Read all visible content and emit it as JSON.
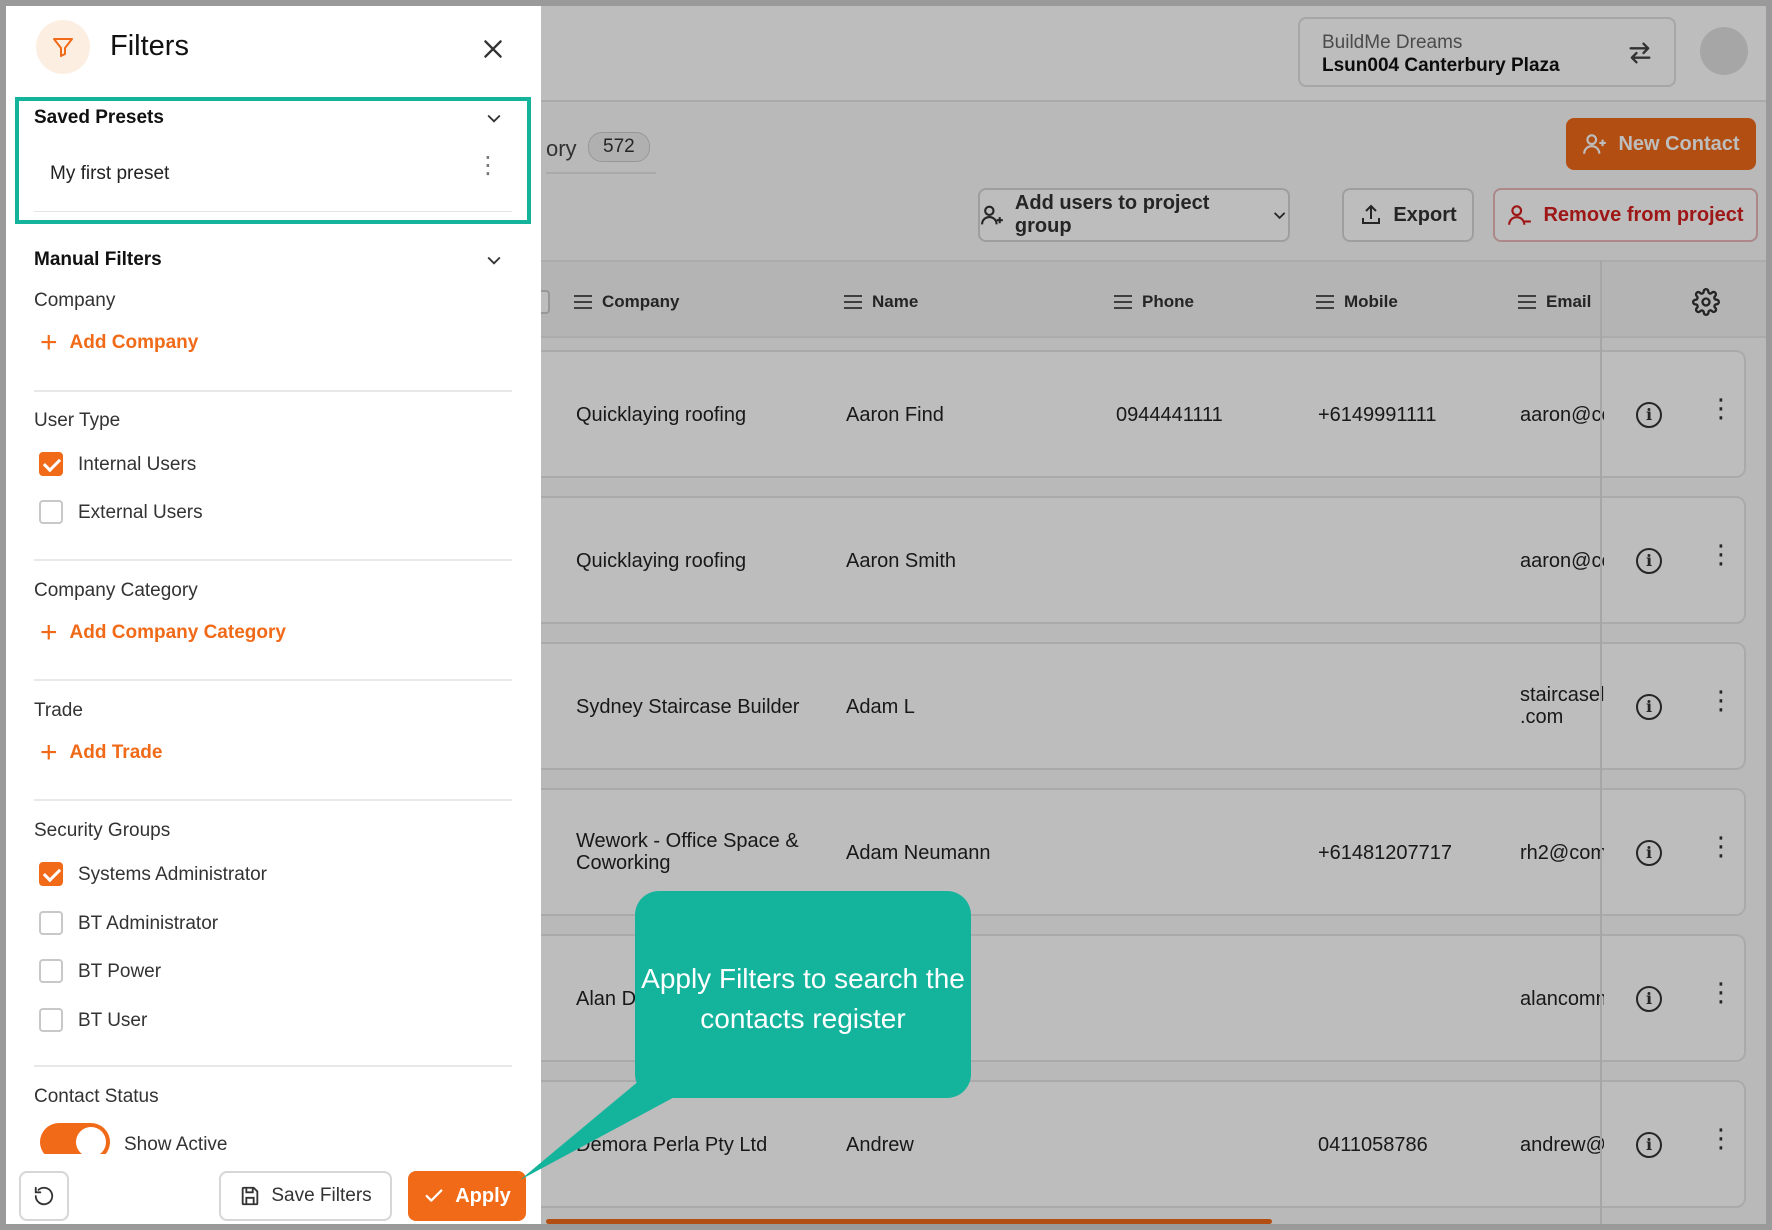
{
  "header": {
    "org_name": "BuildMe Dreams",
    "project_name": "Lsun004 Canterbury Plaza"
  },
  "tab": {
    "label_fragment": "ory",
    "count": "572"
  },
  "actions": {
    "new_contact": "New Contact",
    "add_to_group": "Add users to project group",
    "export": "Export",
    "remove_from_project": "Remove from project"
  },
  "table": {
    "columns": [
      "Company",
      "Name",
      "Phone",
      "Mobile",
      "Email"
    ],
    "rows": [
      {
        "company": "Quicklaying roofing",
        "name": "Aaron Find",
        "phone": "0944441111",
        "mobile": "+6149991111",
        "email": "aaron@cc"
      },
      {
        "company": "Quicklaying roofing",
        "name": "Aaron Smith",
        "phone": "",
        "mobile": "",
        "email": "aaron@cc"
      },
      {
        "company": "Sydney Staircase Builder",
        "name": "Adam L",
        "phone": "",
        "mobile": "",
        "email": "staircasel .com"
      },
      {
        "company": "Wework - Office Space & Coworking",
        "name": "Adam Neumann",
        "phone": "",
        "mobile": "+61481207717",
        "email": "rh2@com"
      },
      {
        "company": "Alan De",
        "name": "",
        "phone": "",
        "mobile": "",
        "email": "alancomn"
      },
      {
        "company": "Demora Perla Pty Ltd",
        "name": "Andrew",
        "phone": "",
        "mobile": "0411058786",
        "email": "andrew@"
      }
    ]
  },
  "filters": {
    "title": "Filters",
    "saved_presets": {
      "title": "Saved Presets",
      "items": [
        "My first preset"
      ]
    },
    "manual_filters": {
      "title": "Manual Filters"
    },
    "company": {
      "label": "Company",
      "add": "Add Company"
    },
    "user_type": {
      "label": "User Type",
      "options": [
        {
          "label": "Internal Users",
          "checked": true
        },
        {
          "label": "External Users",
          "checked": false
        }
      ]
    },
    "company_category": {
      "label": "Company Category",
      "add": "Add Company Category"
    },
    "trade": {
      "label": "Trade",
      "add": "Add Trade"
    },
    "security_groups": {
      "label": "Security Groups",
      "options": [
        {
          "label": "Systems Administrator",
          "checked": true
        },
        {
          "label": "BT Administrator",
          "checked": false
        },
        {
          "label": "BT Power",
          "checked": false
        },
        {
          "label": "BT User",
          "checked": false
        }
      ]
    },
    "contact_status": {
      "label": "Contact Status",
      "toggle_label": "Show Active",
      "on": true
    },
    "footer": {
      "save": "Save Filters",
      "apply": "Apply"
    }
  },
  "callout": {
    "text": "Apply Filters to search the contacts register"
  },
  "colors": {
    "accent": "#f06a18",
    "callout": "#13b39c",
    "danger": "#d5201f"
  }
}
